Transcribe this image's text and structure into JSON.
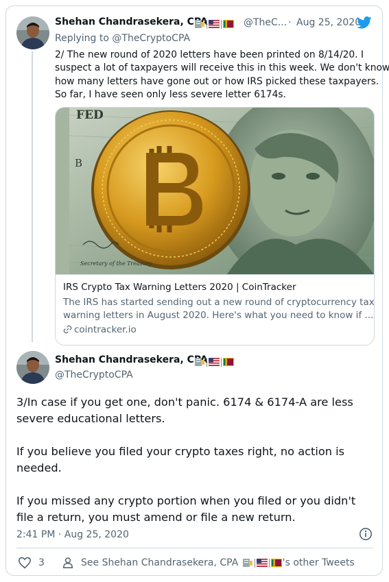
{
  "tweet1": {
    "display_name": "Shehan Chandrasekera, CPA",
    "handle": "@TheC...",
    "dot": "·",
    "date": "Aug 25, 2020",
    "reply_prefix": "Replying to",
    "reply_handle": "@TheCryptoCPA",
    "text_lines": [
      "2/ The new round of 2020 letters have been printed on 8/14/20. I",
      "suspect a lot of taxpayers will receive this in this week. We don't know",
      "how many letters have gone out or how IRS picked these taxpayers.",
      "So far, I have seen only less severe letter 6174s."
    ],
    "link_card": {
      "title": "IRS Crypto Tax Warning Letters 2020 | CoinTracker",
      "description_lines": [
        "The IRS has started sending out a new round of cryptocurrency tax",
        "warning letters in August 2020. Here's what you need to know if ..."
      ],
      "domain": "cointracker.io",
      "image_text": {
        "fed": "FED",
        "signature": "Secretary of the Treasury.",
        "letter_b": "B"
      }
    }
  },
  "tweet2": {
    "display_name": "Shehan Chandrasekera, CPA",
    "handle": "@TheCryptoCPA",
    "paragraphs": [
      [
        "3/In case if you get one, don't panic. 6174 & 6174-A are less",
        "severe educational letters."
      ],
      [
        "If you believe you filed your crypto taxes right, no action is",
        "needed."
      ],
      [
        "If you missed any crypto portion when you filed or you didn't",
        "file a return, you must amend or file a new return."
      ]
    ],
    "time": "2:41 PM · Aug 25, 2020",
    "like_count": "3",
    "see_prefix": "See Shehan Chandrasekera, CPA",
    "see_suffix": "'s other Tweets"
  },
  "icons": {
    "twitter": "twitter-bird-icon",
    "info": "info-icon",
    "heart": "heart-icon",
    "person": "person-icon",
    "link": "link-icon"
  },
  "colors": {
    "twitter_blue": "#1d9bf0",
    "text": "#0f1419",
    "muted": "#536471",
    "border": "#cfd9de"
  }
}
